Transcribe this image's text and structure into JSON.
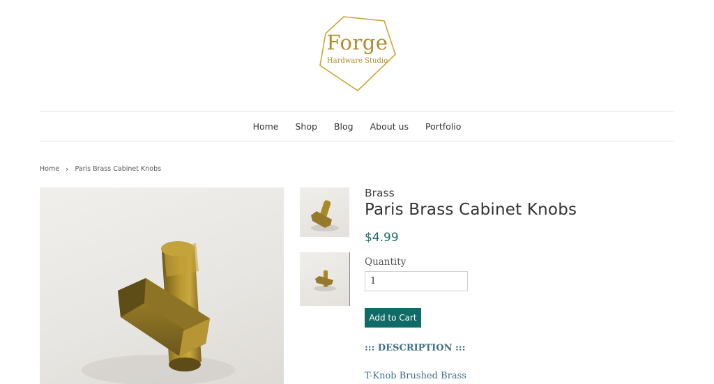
{
  "brand": {
    "title": "Forge",
    "subtitle": "Hardware Studio",
    "color": "#b08a2b"
  },
  "nav": {
    "items": [
      {
        "label": "Home"
      },
      {
        "label": "Shop"
      },
      {
        "label": "Blog"
      },
      {
        "label": "About us"
      },
      {
        "label": "Portfolio"
      }
    ]
  },
  "breadcrumb": {
    "home": "Home",
    "separator": "›",
    "current": "Paris Brass Cabinet Knobs"
  },
  "product": {
    "vendor": "Brass",
    "title": "Paris Brass Cabinet Knobs",
    "price": "$4.99",
    "quantity_label": "Quantity",
    "quantity_value": "1",
    "add_to_cart_label": "Add to Cart",
    "description_heading": "::: DESCRIPTION :::",
    "description_line": "T-Knob Brushed Brass",
    "images": [
      "brass-t-knob-photo",
      "brass-t-knob-thumbnail-1",
      "brass-t-knob-thumbnail-2"
    ]
  },
  "colors": {
    "accent": "#0f6b66",
    "price": "#1e6f6a",
    "description": "#3d6f88"
  }
}
